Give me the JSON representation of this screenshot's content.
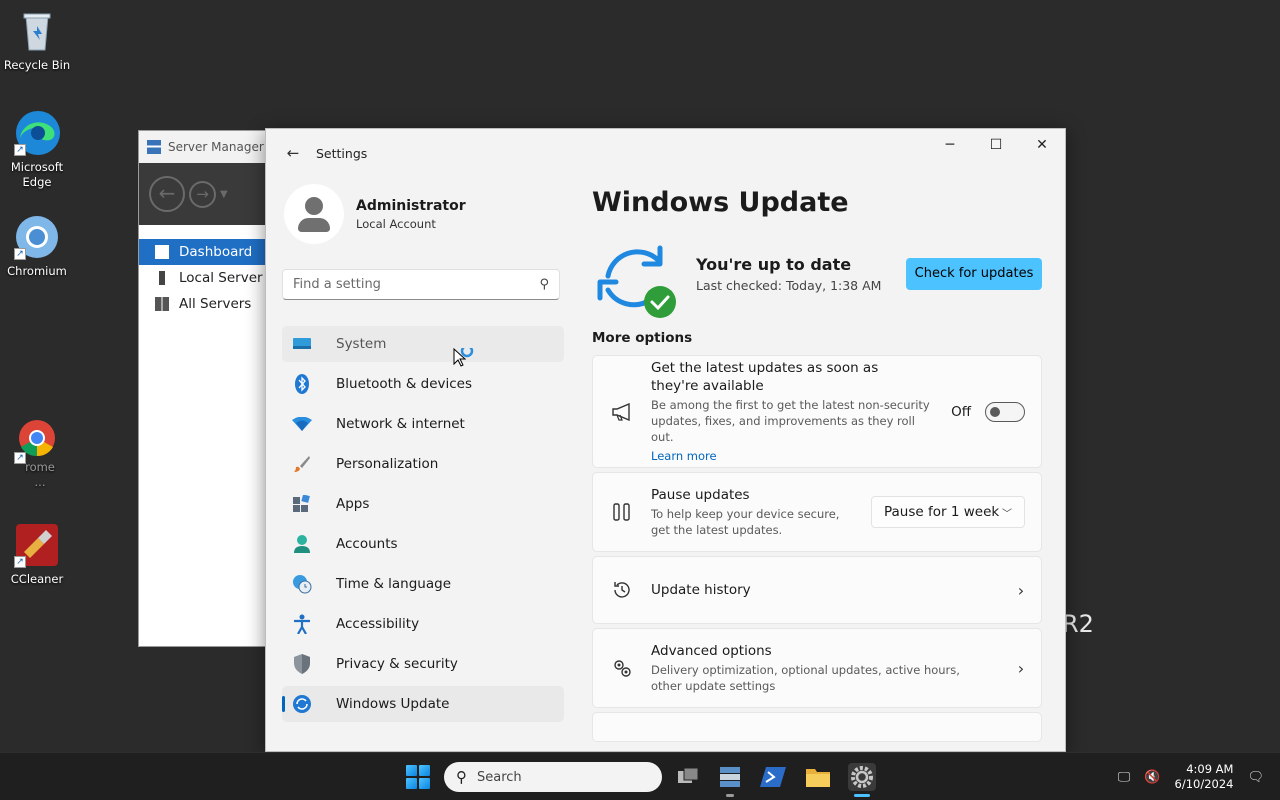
{
  "desktop": {
    "icons": [
      {
        "label": "Recycle Bin"
      },
      {
        "label": "Microsoft Edge"
      },
      {
        "label": "Chromium"
      },
      {
        "label": "rome ..."
      },
      {
        "label": "CCleaner"
      }
    ],
    "partial_text": "R2"
  },
  "server_manager": {
    "title": "Server Manager",
    "items": [
      {
        "label": "Dashboard"
      },
      {
        "label": "Local Server"
      },
      {
        "label": "All Servers"
      }
    ]
  },
  "settings": {
    "window_title": "Settings",
    "profile": {
      "name": "Administrator",
      "account_type": "Local Account"
    },
    "search_placeholder": "Find a setting",
    "nav": [
      {
        "label": "System",
        "icon": "monitor-icon"
      },
      {
        "label": "Bluetooth & devices",
        "icon": "bluetooth-icon"
      },
      {
        "label": "Network & internet",
        "icon": "wifi-icon"
      },
      {
        "label": "Personalization",
        "icon": "brush-icon"
      },
      {
        "label": "Apps",
        "icon": "apps-icon"
      },
      {
        "label": "Accounts",
        "icon": "accounts-icon"
      },
      {
        "label": "Time & language",
        "icon": "clock-globe-icon"
      },
      {
        "label": "Accessibility",
        "icon": "accessibility-icon"
      },
      {
        "label": "Privacy & security",
        "icon": "shield-icon"
      },
      {
        "label": "Windows Update",
        "icon": "update-icon"
      }
    ],
    "page": {
      "title": "Windows Update",
      "status_title": "You're up to date",
      "status_sub": "Last checked: Today, 1:38 AM",
      "check_button": "Check for updates",
      "more_options": "More options",
      "latest": {
        "title": "Get the latest updates as soon as they're available",
        "desc": "Be among the first to get the latest non-security updates, fixes, and improvements as they roll out.",
        "link": "Learn more",
        "toggle_label": "Off"
      },
      "pause": {
        "title": "Pause updates",
        "desc": "To help keep your device secure, get the latest updates.",
        "selected": "Pause for 1 week"
      },
      "history": {
        "title": "Update history"
      },
      "advanced": {
        "title": "Advanced options",
        "desc": "Delivery optimization, optional updates, active hours, other update settings"
      }
    }
  },
  "taskbar": {
    "search_label": "Search",
    "time": "4:09 AM",
    "date": "6/10/2024"
  },
  "colors": {
    "accent": "#0067c0",
    "button": "#4cc2ff",
    "selection": "#1f6fc5"
  }
}
